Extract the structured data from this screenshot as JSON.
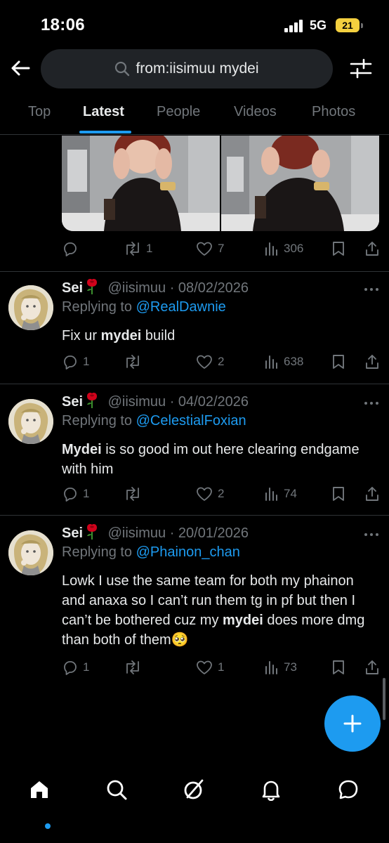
{
  "status_bar": {
    "time": "18:06",
    "network": "5G",
    "battery": "21"
  },
  "search": {
    "query": "from:iisimuu mydei"
  },
  "tabs": [
    {
      "label": "Top"
    },
    {
      "label": "Latest"
    },
    {
      "label": "People"
    },
    {
      "label": "Videos"
    },
    {
      "label": "Photos"
    }
  ],
  "top_post": {
    "replies": "",
    "reposts": "1",
    "likes": "7",
    "views": "306"
  },
  "tweets": [
    {
      "name": "Sei",
      "handle": "@iisimuu",
      "date": "08/02/2026",
      "replying_prefix": "Replying to",
      "replying_to": "@RealDawnie",
      "text_parts": [
        "Fix ur ",
        "mydei",
        " build"
      ],
      "replies": "1",
      "reposts": "",
      "likes": "2",
      "views": "638"
    },
    {
      "name": "Sei",
      "handle": "@iisimuu",
      "date": "04/02/2026",
      "replying_prefix": "Replying to",
      "replying_to": "@CelestialFoxian",
      "text_parts": [
        "Mydei",
        " is so good im out here clearing endgame with him"
      ],
      "replies": "1",
      "reposts": "",
      "likes": "2",
      "views": "74"
    },
    {
      "name": "Sei",
      "handle": "@iisimuu",
      "date": "20/01/2026",
      "replying_prefix": "Replying to",
      "replying_to": "@Phainon_chan",
      "text_parts": [
        "Lowk I use the same team for both my phainon and anaxa so I can’t run them tg in pf but then I can’t be bothered cuz my ",
        "mydei",
        " does more dmg than both of them"
      ],
      "emoji": "🥺",
      "replies": "1",
      "reposts": "",
      "likes": "1",
      "views": "73"
    }
  ],
  "colors": {
    "accent": "#1d9bf0",
    "muted": "#71767b",
    "text": "#e7e9ea",
    "bg": "#000000"
  },
  "icons": [
    "back-arrow-icon",
    "search-icon",
    "filter-icon",
    "reply-icon",
    "repost-icon",
    "like-icon",
    "views-icon",
    "bookmark-icon",
    "share-icon",
    "more-icon",
    "rose-icon",
    "compose-icon",
    "home-icon",
    "explore-icon",
    "grok-icon",
    "notifications-icon",
    "messages-icon"
  ]
}
